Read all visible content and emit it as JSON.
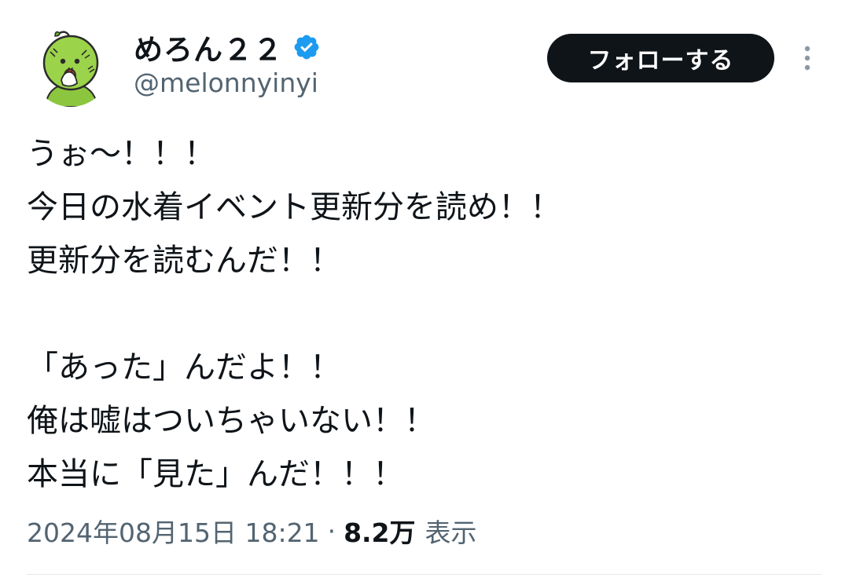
{
  "author": {
    "display_name": "めろん２２",
    "handle": "@melonnyinyi",
    "verified": true,
    "avatar_icon": "melon-character-avatar"
  },
  "actions": {
    "follow_label": "フォローする",
    "more_icon": "more-vertical-icon"
  },
  "tweet": {
    "lines": [
      "うぉ〜！！！",
      "今日の水着イベント更新分を読め！！",
      "更新分を読むんだ！！",
      "",
      "「あった」んだよ！！",
      "俺は嘘はついちゃいない！！",
      "本当に「見た」んだ！！！"
    ]
  },
  "meta": {
    "timestamp": "2024年08月15日 18:21",
    "separator": "·",
    "views_count": "8.2万",
    "views_label": "表示"
  },
  "colors": {
    "text_primary": "#0f1419",
    "text_secondary": "#536471",
    "verified_blue": "#1d9bf0",
    "follow_bg": "#0f1419"
  }
}
